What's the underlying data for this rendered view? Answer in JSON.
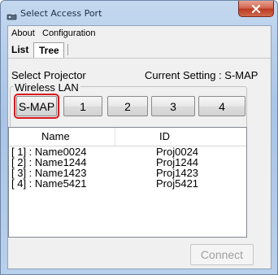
{
  "window": {
    "title": "Select Access Port",
    "close_icon": "close-x-icon",
    "app_icon": "projector-icon"
  },
  "menu": {
    "items": [
      "About",
      "Configuration"
    ]
  },
  "tabs": {
    "items": [
      "List",
      "Tree"
    ],
    "active": "List"
  },
  "selector": {
    "select_label": "Select Projector",
    "current_setting_label": "Current Setting : S-MAP",
    "group_label": "Wireless LAN",
    "buttons": [
      "S-MAP",
      "1",
      "2",
      "3",
      "4"
    ],
    "selected": "S-MAP",
    "selected_outline_color": "#d9181c"
  },
  "projector_list": {
    "columns": [
      "Name",
      "ID"
    ],
    "rows": [
      {
        "name": "[ 1] : Name0024",
        "id": "Proj0024"
      },
      {
        "name": "[ 2] : Name1244",
        "id": "Proj1244"
      },
      {
        "name": "[ 3] : Name1423",
        "id": "Proj1423"
      },
      {
        "name": "[ 4] : Name5421",
        "id": "Proj5421"
      }
    ]
  },
  "actions": {
    "connect_label": "Connect",
    "connect_enabled": false
  }
}
